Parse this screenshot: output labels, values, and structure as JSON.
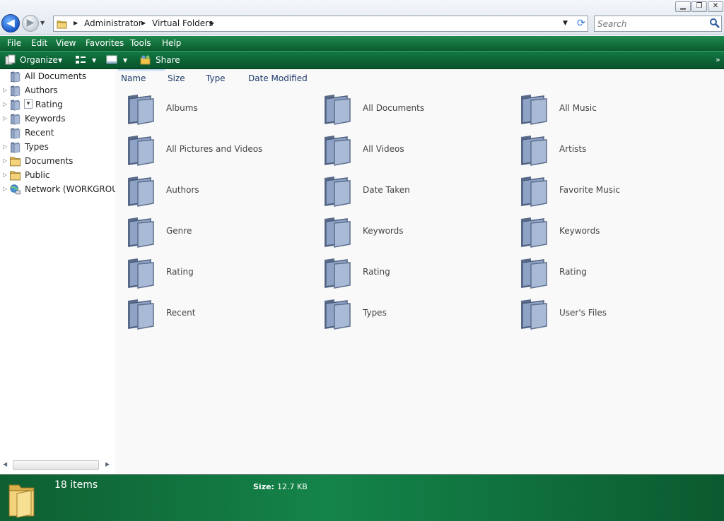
{
  "window": {
    "minimize_glyph": "▁",
    "maximize_glyph": "❐",
    "close_glyph": "✕"
  },
  "address": {
    "crumbs": [
      "Administrator",
      "Virtual Folders"
    ],
    "separator_glyph": "▶",
    "dropdown_glyph": "▼",
    "refresh_glyph": "⟳",
    "icon": "folder-icon"
  },
  "search": {
    "placeholder": "Search",
    "icon": "search-icon"
  },
  "nav": {
    "back_glyph": "◀",
    "forward_glyph": "▶",
    "history_glyph": "▼"
  },
  "menu": {
    "items": [
      "File",
      "Edit",
      "View",
      "Favorites",
      "Tools",
      "Help"
    ]
  },
  "toolbar": {
    "organize_label": "Organize",
    "share_label": "Share",
    "dropdown_glyph": "▼",
    "more_glyph": "»"
  },
  "navpane": {
    "items": [
      {
        "label": "All Documents",
        "icon": "virtual-folder-icon",
        "expandable": false
      },
      {
        "label": "Authors",
        "icon": "virtual-folder-icon",
        "expandable": true
      },
      {
        "label": "Rating",
        "icon": "virtual-folder-icon",
        "expandable": true
      },
      {
        "label": "Keywords",
        "icon": "virtual-folder-icon",
        "expandable": true
      },
      {
        "label": "Recent",
        "icon": "virtual-folder-icon",
        "expandable": false
      },
      {
        "label": "Types",
        "icon": "virtual-folder-icon",
        "expandable": true
      },
      {
        "label": "Documents",
        "icon": "yellow-folder-icon",
        "expandable": true
      },
      {
        "label": "Public",
        "icon": "yellow-folder-icon",
        "expandable": true
      },
      {
        "label": "Network (WORKGROUP",
        "icon": "network-icon",
        "expandable": true
      }
    ],
    "expander_glyph": "▷",
    "scroll_left_glyph": "◀",
    "scroll_right_glyph": "▶"
  },
  "columns": [
    "Name",
    "Size",
    "Type",
    "Date Modified"
  ],
  "items": [
    "Albums",
    "All Documents",
    "All Music",
    "All Pictures and Videos",
    "All Videos",
    "Artists",
    "Authors",
    "Date Taken",
    "Favorite Music",
    "Genre",
    "Keywords",
    "Keywords",
    "Rating",
    "Rating",
    "Rating",
    "Recent",
    "Types",
    "User's Files"
  ],
  "status": {
    "count": "18 items",
    "size_label": "Size:",
    "size_value": "12.7 KB"
  },
  "colors": {
    "menubar": "#1e8a4d",
    "toolbar": "#0c6436",
    "statusbar": "#14844a",
    "virtual_folder": "#7f93b6"
  }
}
